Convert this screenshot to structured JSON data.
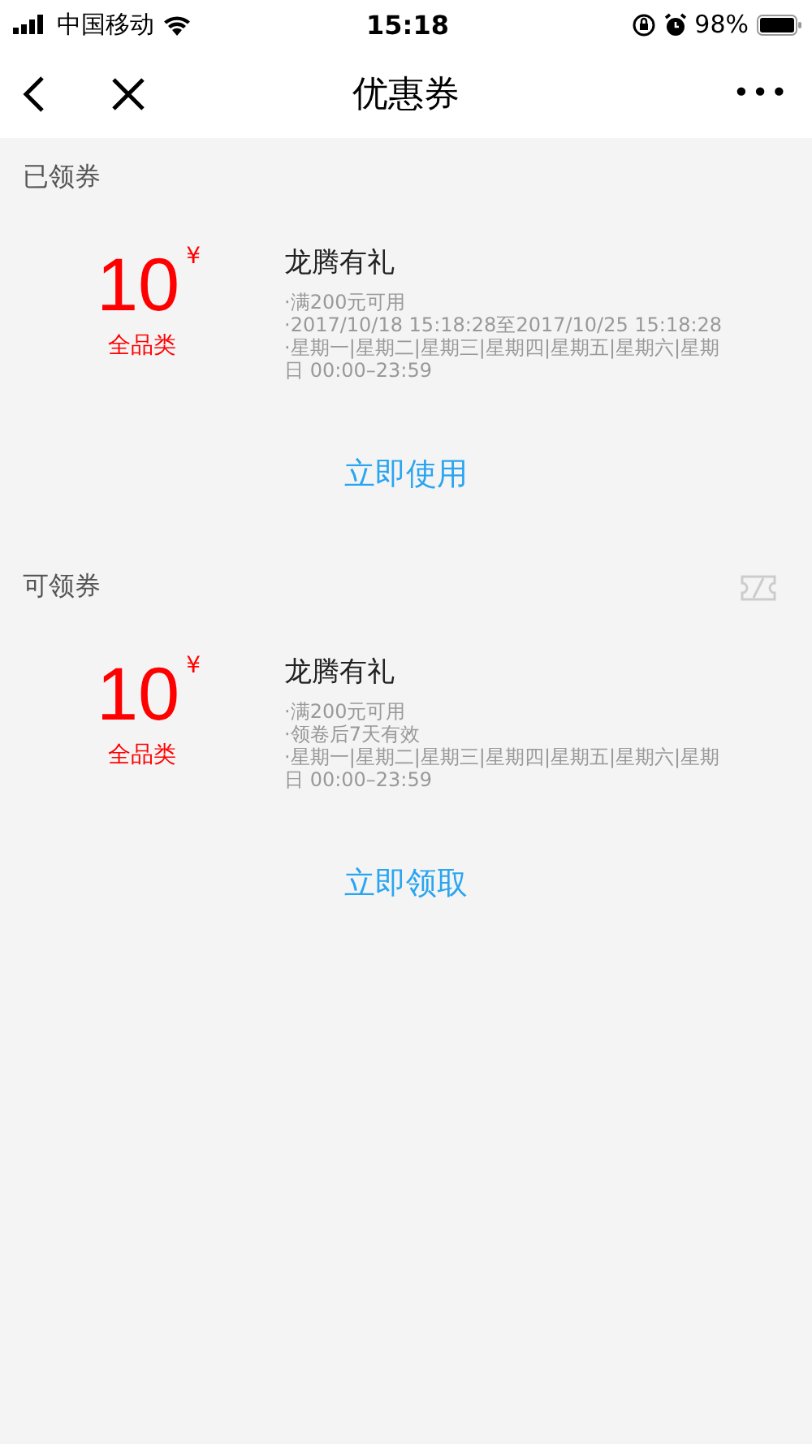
{
  "status_bar": {
    "carrier": "中国移动",
    "time": "15:18",
    "battery": "98%"
  },
  "nav": {
    "title": "优惠券",
    "more": "•••"
  },
  "sections": [
    {
      "title": "已领券",
      "ticket_icon": false,
      "coupon": {
        "amount": "10",
        "currency": "¥",
        "scope": "全品类",
        "name": "龙腾有礼",
        "details": [
          "·满200元可用",
          "·2017/10/18 15:18:28至2017/10/25 15:18:28",
          "·星期一|星期二|星期三|星期四|星期五|星期六|星期日 00:00–23:59"
        ]
      },
      "action": "立即使用"
    },
    {
      "title": "可领券",
      "ticket_icon": true,
      "coupon": {
        "amount": "10",
        "currency": "¥",
        "scope": "全品类",
        "name": "龙腾有礼",
        "details": [
          "·满200元可用",
          "·领卷后7天有效",
          "·星期一|星期二|星期三|星期四|星期五|星期六|星期日 00:00–23:59"
        ]
      },
      "action": "立即领取"
    }
  ]
}
